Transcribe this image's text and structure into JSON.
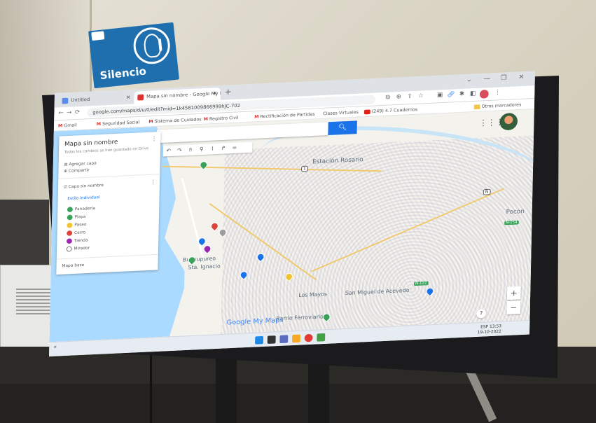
{
  "sign": {
    "text": "Silencio"
  },
  "browser": {
    "tabs": [
      {
        "label": "Untitled"
      },
      {
        "label": "Mapa sin nombre - Google My Maps"
      }
    ],
    "url": "google.com/maps/d/u/0/edit?mid=1k4581009866999hJC-702",
    "bookmarks": [
      "Gmail",
      "Seguridad Social",
      "Sistema de Cuidados",
      "Registro Civil",
      "Rectificación de Partidas",
      "Clases Virtuales",
      "(249) 4.7 Cuadernos",
      "Otros marcadores"
    ]
  },
  "map": {
    "search_placeholder": "",
    "panel": {
      "title": "Mapa sin nombre",
      "subtitle": "Todos los cambios se han guardado en Drive",
      "add_layer": "Agregar capa",
      "share": "Compartir",
      "layer_name": "Capa sin nombre",
      "layer_link": "Estilo individual",
      "items": [
        {
          "label": "Panadería",
          "color": "#3aa35a"
        },
        {
          "label": "Playa",
          "color": "#3aa35a"
        },
        {
          "label": "Paseo",
          "color": "#f1c232"
        },
        {
          "label": "Cerro",
          "color": "#db4437"
        },
        {
          "label": "Tienda",
          "color": "#9c27b0"
        },
        {
          "label": "Mirador",
          "color": "#ffffff"
        }
      ],
      "basemap": "Mapa base"
    },
    "places": [
      "Estación Rosario",
      "Pocon",
      "Buchupureo",
      "Sta. Ignacio",
      "Los Mayos",
      "San Miguel de Acevedo",
      "Barrio Ferroviario"
    ],
    "highways": [
      "N-154",
      "N-122"
    ],
    "routes": [
      "1",
      "N"
    ],
    "brand": "Google My Maps"
  },
  "taskbar": {
    "time": "13:53",
    "date": "19-10-2022",
    "lang": "ESP"
  }
}
